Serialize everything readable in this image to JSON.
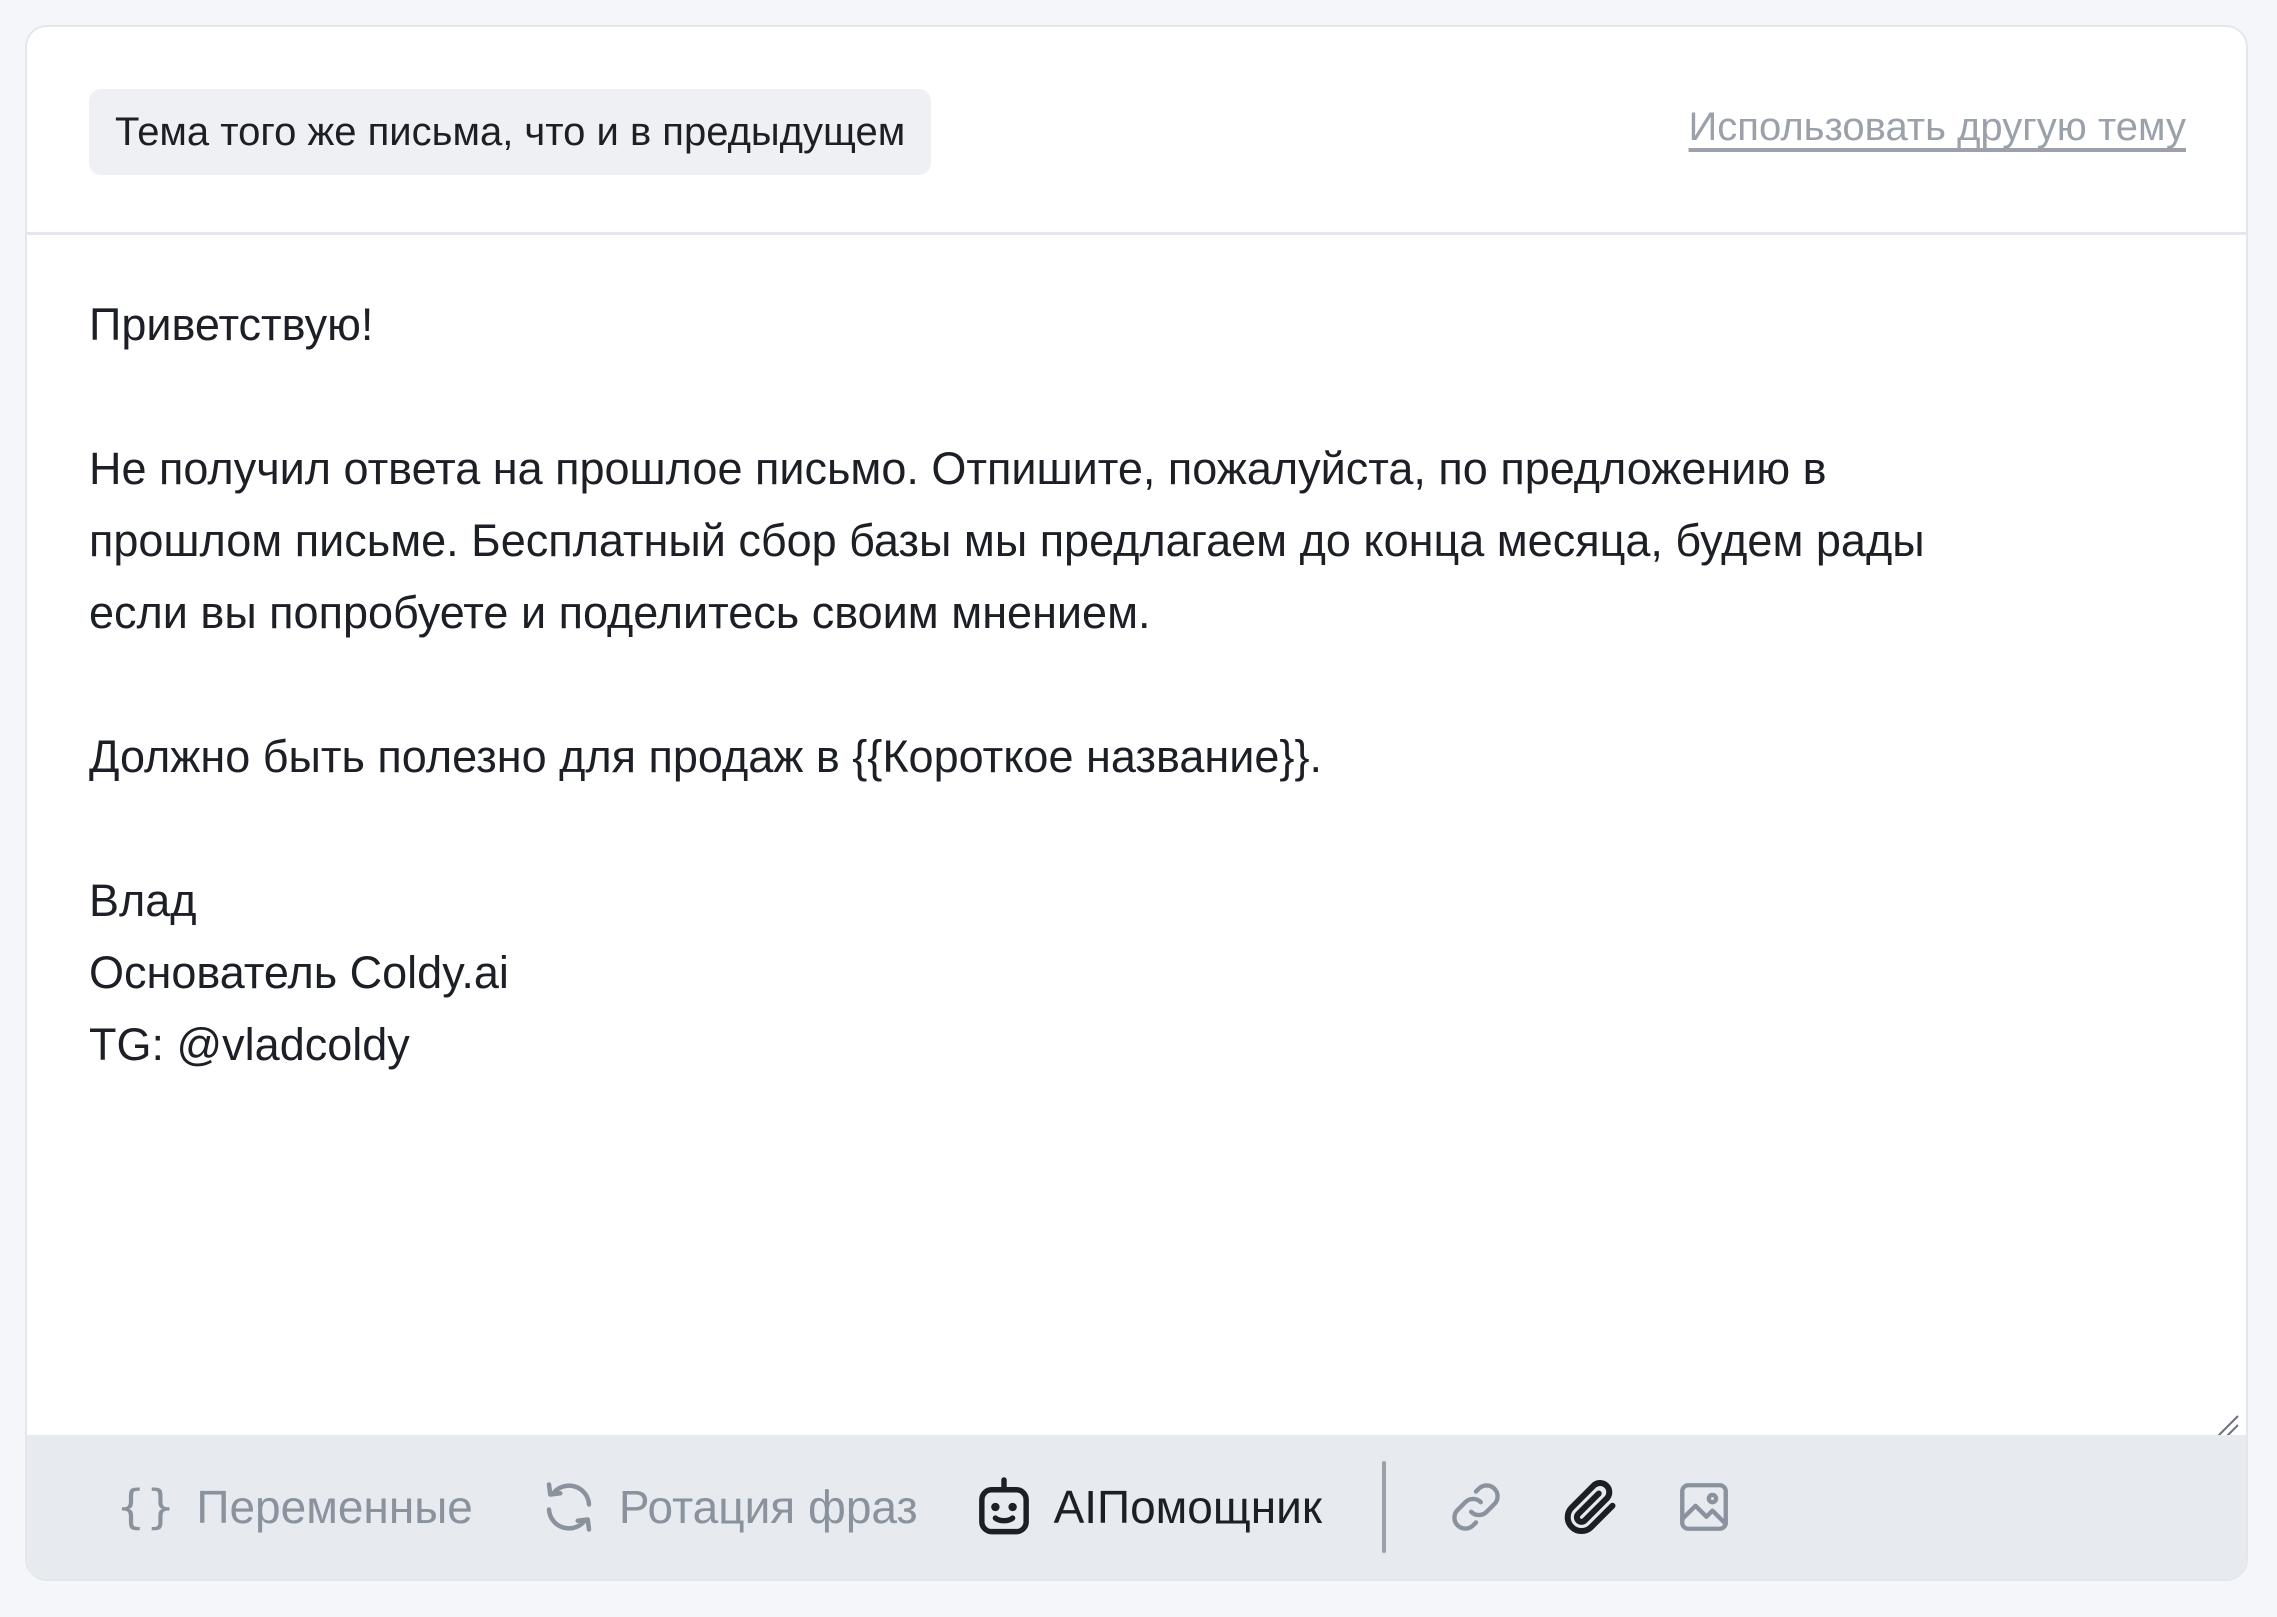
{
  "subject": {
    "current": "Тема того же письма, что и в предыдущем",
    "alt_link": "Использовать другую тему"
  },
  "body": {
    "greeting": "Приветствую!",
    "paragraph1_line1": "Не получил ответа на прошлое письмо. Отпишите, пожалуйста, по предложению в",
    "paragraph1_line2": "прошлом письме. Бесплатный сбор базы мы предлагаем до конца месяца, будем рады",
    "paragraph1_line3": "если вы попробуете и поделитесь своим мнением.",
    "paragraph2": "Должно быть полезно для продаж в {{Короткое название}}.",
    "signature_name": "Влад",
    "signature_title": "Основатель Coldy.ai",
    "signature_contact": "TG: @vladcoldy"
  },
  "toolbar": {
    "variables_glyph": "{}",
    "variables_label": "Переменные",
    "rotation_label": "Ротация фраз",
    "ai_label": "AIПомощник",
    "icons": [
      "curly-braces-icon",
      "rotate-icon",
      "robot-icon",
      "link-icon",
      "paperclip-icon",
      "image-icon"
    ]
  },
  "colors": {
    "page_bg": "#f4f6f9",
    "card_bg": "#ffffff",
    "border": "#e3e7ed",
    "pill_bg": "#eef0f3",
    "toolbar_bg": "#e7ebf0",
    "text": "#1c1f26",
    "muted": "#8a929d",
    "link": "#9aa1ab"
  }
}
